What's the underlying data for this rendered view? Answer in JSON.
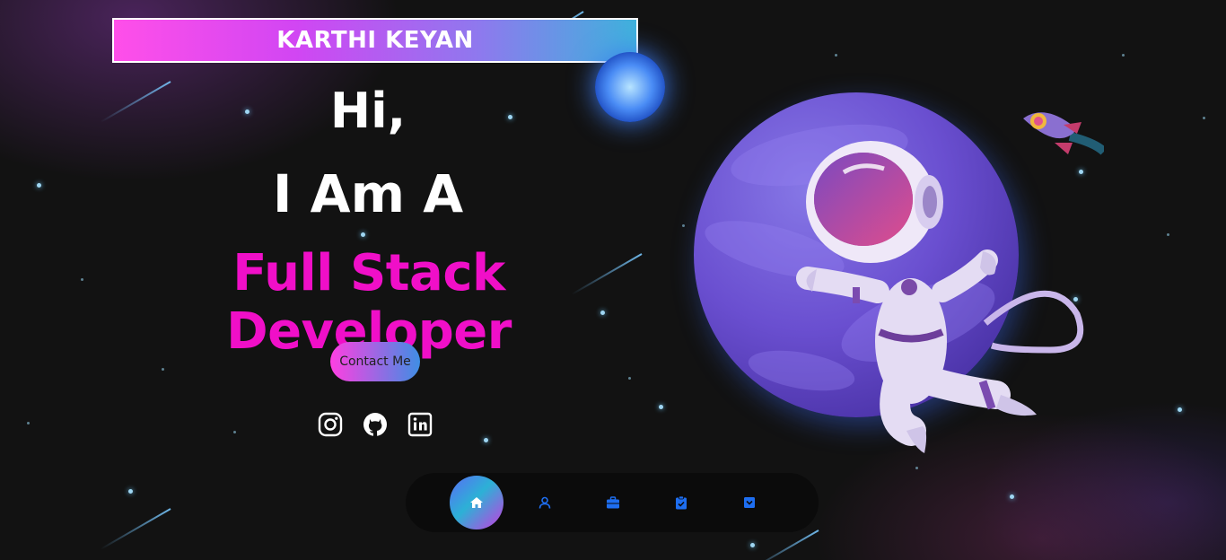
{
  "brand": {
    "name": "KARTHI KEYAN"
  },
  "hero": {
    "greeting": "Hi,",
    "intro": "I Am A",
    "role": "Full Stack Developer"
  },
  "actions": {
    "contact_label": "Contact Me"
  },
  "social": [
    "instagram-icon",
    "github-icon",
    "linkedin-icon"
  ],
  "nav": {
    "items": [
      "home-icon",
      "user-icon",
      "briefcase-icon",
      "clipboard-check-icon",
      "inbox-icon"
    ],
    "active": "home-icon"
  },
  "colors": {
    "background": "#121212",
    "accent_pink": "#f00fc8",
    "brand_gradient": [
      "#ff4fe9",
      "#3fb2dc"
    ],
    "nav_icon": "#1e6ef0"
  }
}
